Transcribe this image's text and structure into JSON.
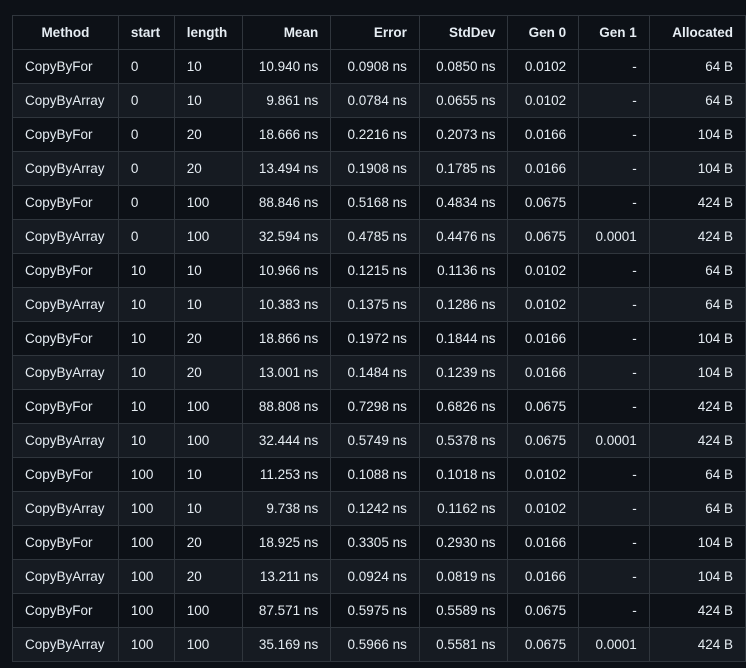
{
  "table": {
    "headers": [
      "Method",
      "start",
      "length",
      "Mean",
      "Error",
      "StdDev",
      "Gen 0",
      "Gen 1",
      "Allocated"
    ],
    "rows": [
      [
        "CopyByFor",
        "0",
        "10",
        "10.940 ns",
        "0.0908 ns",
        "0.0850 ns",
        "0.0102",
        "-",
        "64 B"
      ],
      [
        "CopyByArray",
        "0",
        "10",
        "9.861 ns",
        "0.0784 ns",
        "0.0655 ns",
        "0.0102",
        "-",
        "64 B"
      ],
      [
        "CopyByFor",
        "0",
        "20",
        "18.666 ns",
        "0.2216 ns",
        "0.2073 ns",
        "0.0166",
        "-",
        "104 B"
      ],
      [
        "CopyByArray",
        "0",
        "20",
        "13.494 ns",
        "0.1908 ns",
        "0.1785 ns",
        "0.0166",
        "-",
        "104 B"
      ],
      [
        "CopyByFor",
        "0",
        "100",
        "88.846 ns",
        "0.5168 ns",
        "0.4834 ns",
        "0.0675",
        "-",
        "424 B"
      ],
      [
        "CopyByArray",
        "0",
        "100",
        "32.594 ns",
        "0.4785 ns",
        "0.4476 ns",
        "0.0675",
        "0.0001",
        "424 B"
      ],
      [
        "CopyByFor",
        "10",
        "10",
        "10.966 ns",
        "0.1215 ns",
        "0.1136 ns",
        "0.0102",
        "-",
        "64 B"
      ],
      [
        "CopyByArray",
        "10",
        "10",
        "10.383 ns",
        "0.1375 ns",
        "0.1286 ns",
        "0.0102",
        "-",
        "64 B"
      ],
      [
        "CopyByFor",
        "10",
        "20",
        "18.866 ns",
        "0.1972 ns",
        "0.1844 ns",
        "0.0166",
        "-",
        "104 B"
      ],
      [
        "CopyByArray",
        "10",
        "20",
        "13.001 ns",
        "0.1484 ns",
        "0.1239 ns",
        "0.0166",
        "-",
        "104 B"
      ],
      [
        "CopyByFor",
        "10",
        "100",
        "88.808 ns",
        "0.7298 ns",
        "0.6826 ns",
        "0.0675",
        "-",
        "424 B"
      ],
      [
        "CopyByArray",
        "10",
        "100",
        "32.444 ns",
        "0.5749 ns",
        "0.5378 ns",
        "0.0675",
        "0.0001",
        "424 B"
      ],
      [
        "CopyByFor",
        "100",
        "10",
        "11.253 ns",
        "0.1088 ns",
        "0.1018 ns",
        "0.0102",
        "-",
        "64 B"
      ],
      [
        "CopyByArray",
        "100",
        "10",
        "9.738 ns",
        "0.1242 ns",
        "0.1162 ns",
        "0.0102",
        "-",
        "64 B"
      ],
      [
        "CopyByFor",
        "100",
        "20",
        "18.925 ns",
        "0.3305 ns",
        "0.2930 ns",
        "0.0166",
        "-",
        "104 B"
      ],
      [
        "CopyByArray",
        "100",
        "20",
        "13.211 ns",
        "0.0924 ns",
        "0.0819 ns",
        "0.0166",
        "-",
        "104 B"
      ],
      [
        "CopyByFor",
        "100",
        "100",
        "87.571 ns",
        "0.5975 ns",
        "0.5589 ns",
        "0.0675",
        "-",
        "424 B"
      ],
      [
        "CopyByArray",
        "100",
        "100",
        "35.169 ns",
        "0.5966 ns",
        "0.5581 ns",
        "0.0675",
        "0.0001",
        "424 B"
      ]
    ]
  },
  "colors": {
    "background": "#0d1117",
    "row_alt": "#161b22",
    "border": "#30363d",
    "text": "#e6edf3"
  }
}
